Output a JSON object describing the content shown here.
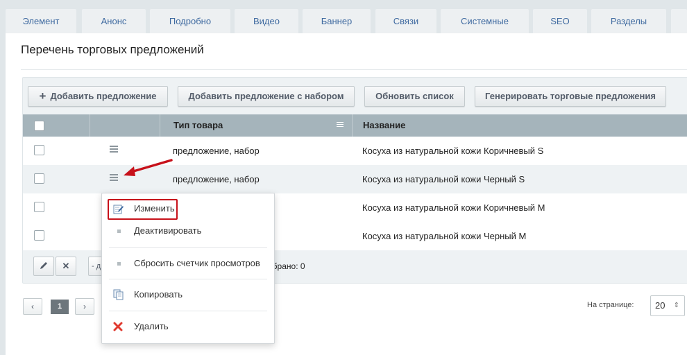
{
  "tabs": [
    "Элемент",
    "Анонс",
    "Подробно",
    "Видео",
    "Баннер",
    "Связи",
    "Системные",
    "SEO",
    "Разделы"
  ],
  "page_title": "Перечень торговых предложений",
  "toolbar": {
    "add_offer": "Добавить предложение",
    "add_offer_set": "Добавить предложение с набором",
    "refresh": "Обновить список",
    "generate": "Генерировать торговые предложения"
  },
  "columns": {
    "type": "Тип товара",
    "name": "Название"
  },
  "rows": [
    {
      "type": "предложение, набор",
      "name": "Косуха из натуральной кожи Коричневый S"
    },
    {
      "type": "предложение, набор",
      "name": "Косуха из натуральной кожи Черный S"
    },
    {
      "type": "",
      "name": "Косуха из натуральной кожи Коричневый M"
    },
    {
      "type": "",
      "name": "Косуха из натуральной кожи Черный M"
    }
  ],
  "footer": {
    "partial_action": "- д",
    "selected": "обрано: 0"
  },
  "pagination": {
    "prev": "‹",
    "current": "1",
    "next": "›",
    "per_page_label": "На странице:",
    "per_page_value": "20"
  },
  "context_menu": {
    "edit": "Изменить",
    "deactivate": "Деактивировать",
    "reset_views": "Сбросить счетчик просмотров",
    "copy": "Копировать",
    "delete": "Удалить"
  },
  "colors": {
    "highlight": "#c7111a",
    "tab_text": "#3f6aa0"
  },
  "icons": [
    "plus-icon",
    "pencil-icon",
    "close-icon",
    "burger-menu-icon",
    "edit-icon",
    "copy-icon",
    "delete-icon",
    "red-arrow-icon"
  ]
}
